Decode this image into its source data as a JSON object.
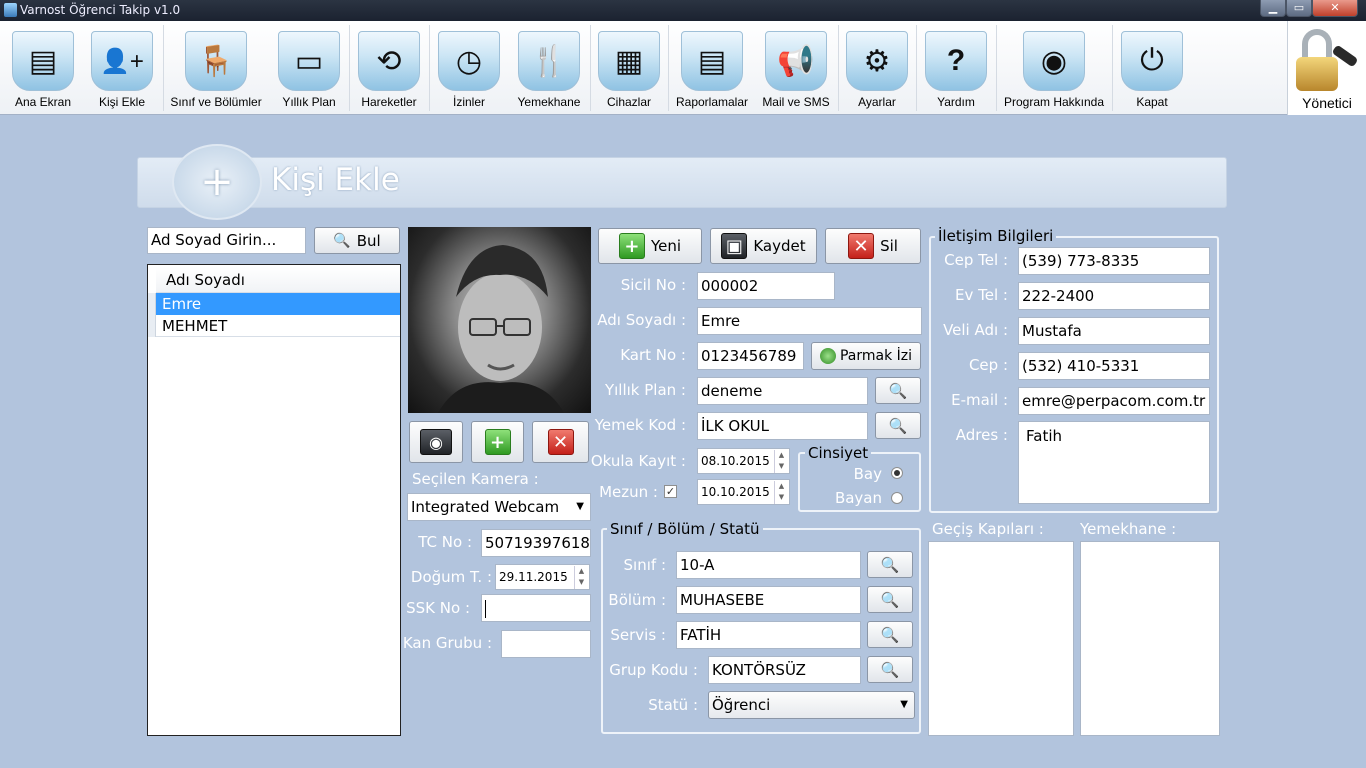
{
  "window": {
    "title": "Varnost Öğrenci Takip v1.0",
    "minimize_glyph": "▁",
    "maximize_glyph": "▭",
    "close_glyph": "✕"
  },
  "toolbar": {
    "items": [
      {
        "label": "Ana Ekran",
        "icon": "dashboard-icon",
        "glyph": "▤"
      },
      {
        "label": "Kişi Ekle",
        "icon": "add-person-icon",
        "glyph": "👤+"
      },
      {
        "label": "Sınıf ve Bölümler",
        "icon": "classroom-icon",
        "glyph": "🪑"
      },
      {
        "label": "Yıllık Plan",
        "icon": "teacher-board-icon",
        "glyph": "▭"
      },
      {
        "label": "Hareketler",
        "icon": "refresh-arrows-icon",
        "glyph": "⟲"
      },
      {
        "label": "İzinler",
        "icon": "clock-calendar-icon",
        "glyph": "◷"
      },
      {
        "label": "Yemekhane",
        "icon": "cutlery-icon",
        "glyph": "🍴"
      },
      {
        "label": "Cihazlar",
        "icon": "terminal-device-icon",
        "glyph": "▦"
      },
      {
        "label": "Raporlamalar",
        "icon": "report-document-icon",
        "glyph": "▤"
      },
      {
        "label": "Mail ve SMS",
        "icon": "megaphone-icon",
        "glyph": "📢"
      },
      {
        "label": "Ayarlar",
        "icon": "gear-icon",
        "glyph": "⚙"
      },
      {
        "label": "Yardım",
        "icon": "help-question-icon",
        "glyph": "?"
      },
      {
        "label": "Program Hakkında",
        "icon": "software-box-icon",
        "glyph": "◉"
      },
      {
        "label": "Kapat",
        "icon": "power-icon",
        "glyph": "⏻"
      }
    ],
    "admin_label": "Yönetici"
  },
  "header": {
    "title": "Kişi Ekle",
    "icon_glyph": "+"
  },
  "search": {
    "placeholder": "Ad Soyad Girin...",
    "button_label": "Bul"
  },
  "people_list": {
    "column_header": "Adı Soyadı",
    "rows": [
      "Emre",
      "MEHMET"
    ],
    "selected_index": 0
  },
  "photo": {
    "camera_label": "Seçilen Kamera :",
    "camera_value": "Integrated Webcam"
  },
  "actions": {
    "new_label": "Yeni",
    "save_label": "Kaydet",
    "delete_label": "Sil",
    "fingerprint_label": "Parmak İzi"
  },
  "form": {
    "sicil_label": "Sicil No :",
    "sicil_value": "000002",
    "adsoyad_label": "Adı Soyadı :",
    "adsoyad_value": "Emre",
    "kart_label": "Kart No :",
    "kart_value": "0123456789",
    "plan_label": "Yıllık Plan :",
    "plan_value": "deneme",
    "yemek_label": "Yemek Kod :",
    "yemek_value": "İLK OKUL",
    "kayit_label": "Okula Kayıt :",
    "kayit_value": "08.10.2015",
    "mezun_label": "Mezun :",
    "mezun_checked": true,
    "mezun_value": "10.10.2015",
    "tc_label": "TC No :",
    "tc_value": "50719397618",
    "dogum_label": "Doğum T. :",
    "dogum_value": "29.11.2015",
    "ssk_label": "SSK No :",
    "ssk_value": "",
    "kan_label": "Kan Grubu :",
    "kan_value": ""
  },
  "gender": {
    "title": "Cinsiyet",
    "male_label": "Bay",
    "female_label": "Bayan",
    "selected": "Bay"
  },
  "class_group": {
    "title": "Sınıf / Bölüm / Statü",
    "sinif_label": "Sınıf :",
    "sinif_value": "10-A",
    "bolum_label": "Bölüm :",
    "bolum_value": "MUHASEBE",
    "servis_label": "Servis :",
    "servis_value": "FATİH",
    "grup_label": "Grup Kodu :",
    "grup_value": "KONTÖRSÜZ",
    "statu_label": "Statü :",
    "statu_value": "Öğrenci"
  },
  "contact": {
    "title": "İletişim Bilgileri",
    "cep_label": "Cep Tel :",
    "cep_value": "(539) 773-8335",
    "ev_label": "Ev Tel :",
    "ev_value": "222-2400",
    "veli_label": "Veli Adı :",
    "veli_value": "Mustafa",
    "velicep_label": "Cep :",
    "velicep_value": "(532) 410-5331",
    "email_label": "E-mail :",
    "email_value": "emre@perpacom.com.tr",
    "adres_label": "Adres :",
    "adres_value": "Fatih"
  },
  "access": {
    "gates_label": "Geçiş Kapıları :",
    "canteen_label": "Yemekhane :"
  }
}
